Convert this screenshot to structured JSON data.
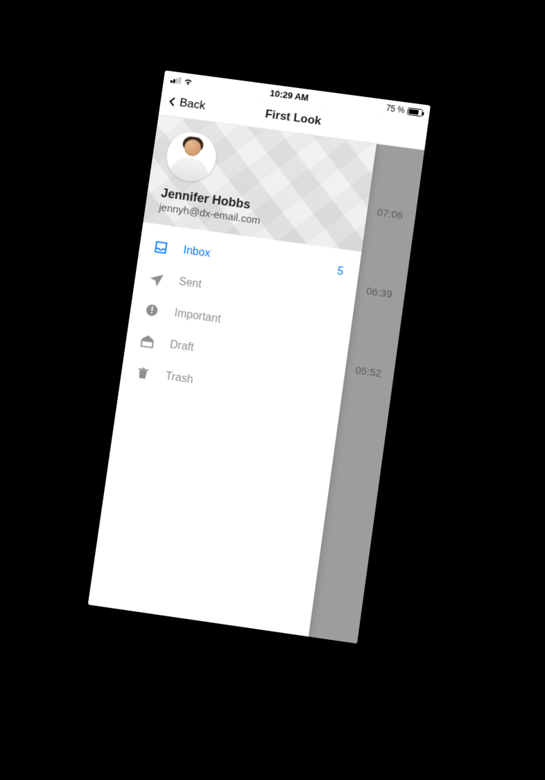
{
  "status": {
    "time": "10:29 AM",
    "battery_text": "75 %"
  },
  "nav": {
    "back_label": "Back",
    "title": "First Look"
  },
  "profile": {
    "name": "Jennifer Hobbs",
    "email": "jennyh@dx-email.com"
  },
  "menu": {
    "items": [
      {
        "label": "Inbox",
        "active": true,
        "badge": "5"
      },
      {
        "label": "Sent",
        "active": false
      },
      {
        "label": "Important",
        "active": false
      },
      {
        "label": "Draft",
        "active": false
      },
      {
        "label": "Trash",
        "active": false
      }
    ]
  },
  "underlying": {
    "times": [
      "07:06",
      "06:39",
      "05:52"
    ]
  }
}
